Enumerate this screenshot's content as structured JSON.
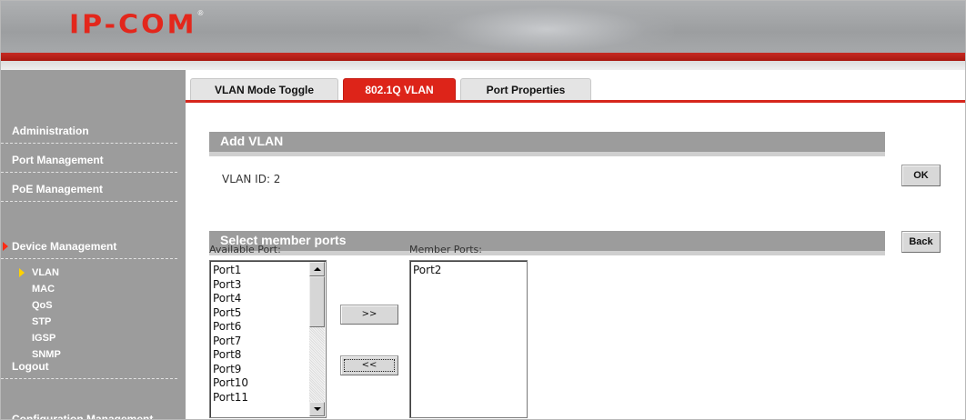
{
  "brand": {
    "logo_text": "IP-COM",
    "registered_mark": "®"
  },
  "sidebar": {
    "items": [
      {
        "label": "Administration",
        "active": false
      },
      {
        "label": "Port Management",
        "active": false
      },
      {
        "label": "PoE Management",
        "active": false
      },
      {
        "label": "Device Management",
        "active": true
      },
      {
        "label": "Logout",
        "active": false
      },
      {
        "label": "Configuration Management",
        "active": false
      }
    ],
    "subitems": [
      {
        "label": "VLAN",
        "active": true
      },
      {
        "label": "MAC",
        "active": false
      },
      {
        "label": "QoS",
        "active": false
      },
      {
        "label": "STP",
        "active": false
      },
      {
        "label": "IGSP",
        "active": false
      },
      {
        "label": "SNMP",
        "active": false
      }
    ]
  },
  "tabs": [
    {
      "label": "VLAN Mode Toggle",
      "active": false
    },
    {
      "label": "802.1Q VLAN",
      "active": true
    },
    {
      "label": "Port Properties",
      "active": false
    }
  ],
  "add_vlan": {
    "title": "Add VLAN",
    "vlan_id_text": "VLAN ID: 2"
  },
  "member_ports_section": {
    "title": "Select member ports",
    "available_label": "Available Port:",
    "member_label": "Member Ports:",
    "available_ports": [
      "Port1",
      "Port3",
      "Port4",
      "Port5",
      "Port6",
      "Port7",
      "Port8",
      "Port9",
      "Port10",
      "Port11"
    ],
    "member_ports": [
      "Port2"
    ],
    "add_button": ">>",
    "remove_button": "<<"
  },
  "actions": {
    "ok": "OK",
    "back": "Back"
  },
  "colors": {
    "accent_red": "#d6261c",
    "sidebar_gray": "#9c9c9c",
    "section_gray": "#9c9c9c",
    "sub_arrow_yellow": "#ffd200"
  }
}
